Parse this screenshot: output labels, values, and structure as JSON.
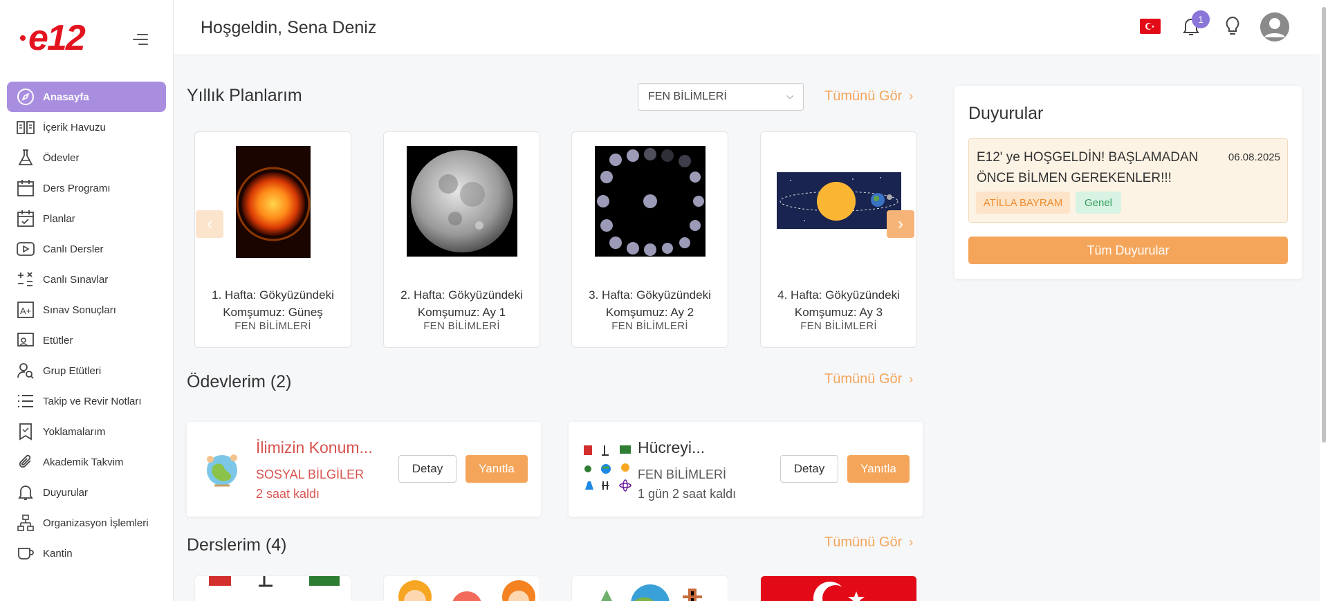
{
  "brand": {
    "logo_text": "e12"
  },
  "header": {
    "welcome": "Hoşgeldin, Sena Deniz",
    "notification_count": "1"
  },
  "sidebar": {
    "items": [
      {
        "label": "Anasayfa",
        "icon": "compass-icon",
        "active": true
      },
      {
        "label": "İçerik Havuzu",
        "icon": "book-open-icon"
      },
      {
        "label": "Ödevler",
        "icon": "flask-icon"
      },
      {
        "label": "Ders Programı",
        "icon": "calendar-icon"
      },
      {
        "label": "Planlar",
        "icon": "calendar-check-icon"
      },
      {
        "label": "Canlı Dersler",
        "icon": "play-icon"
      },
      {
        "label": "Canlı Sınavlar",
        "icon": "math-ops-icon"
      },
      {
        "label": "Sınav Sonuçları",
        "icon": "grade-icon"
      },
      {
        "label": "Etütler",
        "icon": "presentation-icon"
      },
      {
        "label": "Grup Etütleri",
        "icon": "user-search-icon"
      },
      {
        "label": "Takip ve Revir Notları",
        "icon": "list-icon"
      },
      {
        "label": "Yoklamalarım",
        "icon": "bookmark-icon"
      },
      {
        "label": "Akademik Takvim",
        "icon": "paperclip-icon"
      },
      {
        "label": "Duyurular",
        "icon": "bell-icon"
      },
      {
        "label": "Organizasyon İşlemleri",
        "icon": "org-chart-icon"
      },
      {
        "label": "Kantin",
        "icon": "cup-icon"
      }
    ]
  },
  "plans": {
    "title": "Yıllık Planlarım",
    "select_value": "FEN BİLİMLERİ",
    "see_all": "Tümünü Gör",
    "cards": [
      {
        "title_line1": "1. Hafta: Gökyüzündeki",
        "title_line2": "Komşumuz: Güneş",
        "subject": "FEN BİLİMLERİ"
      },
      {
        "title_line1": "2. Hafta: Gökyüzündeki",
        "title_line2": "Komşumuz: Ay 1",
        "subject": "FEN BİLİMLERİ"
      },
      {
        "title_line1": "3. Hafta: Gökyüzündeki",
        "title_line2": "Komşumuz: Ay 2",
        "subject": "FEN BİLİMLERİ"
      },
      {
        "title_line1": "4. Hafta: Gökyüzündeki",
        "title_line2": "Komşumuz: Ay 3",
        "subject": "FEN BİLİMLERİ"
      }
    ]
  },
  "homework": {
    "title": "Ödevlerim (2)",
    "see_all": "Tümünü Gör",
    "detail_label": "Detay",
    "reply_label": "Yanıtla",
    "items": [
      {
        "title": "İlimizin Konum...",
        "subject": "SOSYAL BİLGİLER",
        "time_left": "2 saat kaldı",
        "color": "#d9534f"
      },
      {
        "title": "Hücreyi...",
        "subject": "FEN BİLİMLERİ",
        "time_left": "1 gün 2 saat kaldı",
        "color": "#333333"
      }
    ]
  },
  "lessons": {
    "title": "Derslerim (4)",
    "see_all": "Tümünü Gör"
  },
  "announcements": {
    "title": "Duyurular",
    "item": {
      "text": "E12' ye HOŞGELDİN! BAŞLAMADAN ÖNCE BİLMEN GEREKENLER!!!",
      "date": "06.08.2025",
      "author": "ATİLLA BAYRAM",
      "category": "Genel"
    },
    "all_button": "Tüm Duyurular"
  },
  "colors": {
    "accent": "#f5a55a",
    "active_nav": "#a98ee0",
    "brand_red": "#e3141f"
  }
}
